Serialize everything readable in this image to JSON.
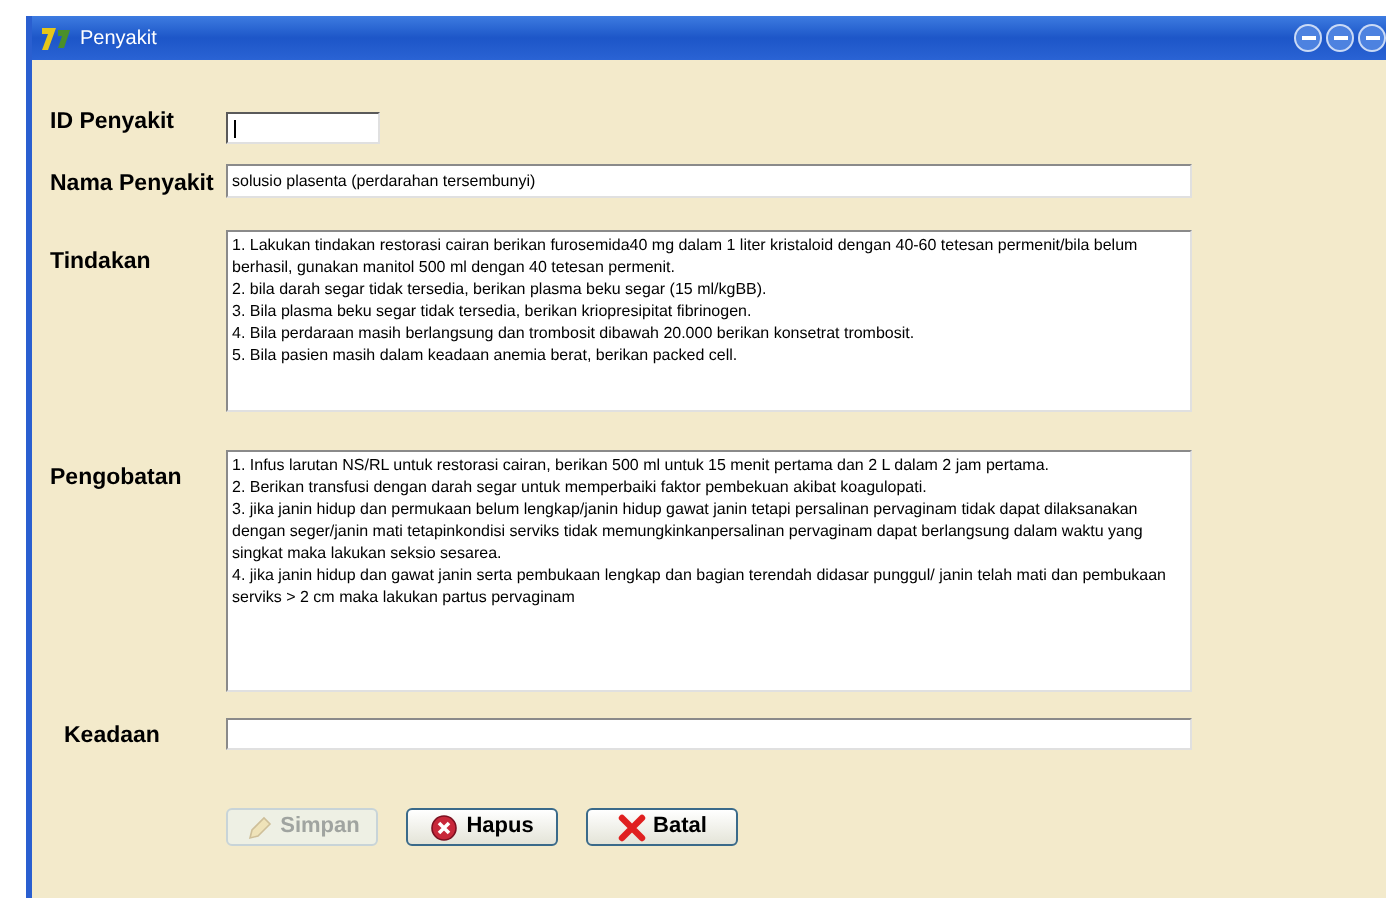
{
  "window": {
    "title": "Penyakit"
  },
  "fields": [
    {
      "label": "ID Penyakit",
      "kind": "short",
      "focused": true
    },
    {
      "label": "Nama Penyakit",
      "kind": "line",
      "value": "solusio plasenta (perdarahan tersembunyi)",
      "focused": false
    },
    {
      "label": "Tindakan",
      "kind": "area",
      "lines": [
        "1. Lakukan tindakan restorasi cairan berikan furosemida40 mg dalam 1 liter kristaloid dengan 40-60 tetesan permenit/bila belum berhasil, gunakan manitol 500 ml dengan 40 tetesan permenit.",
        "2. bila darah segar tidak tersedia, berikan plasma beku segar (15 ml/kgBB).",
        "3. Bila plasma beku segar tidak tersedia, berikan kriopresipitat fibrinogen.",
        "4. Bila perdaraan masih berlangsung dan trombosit dibawah 20.000 berikan konsetrat trombosit.",
        "5. Bila pasien masih dalam keadaan anemia berat, berikan packed cell."
      ],
      "focused": false
    },
    {
      "label": "Pengobatan",
      "kind": "area",
      "lines": [
        "1. Infus larutan NS/RL untuk restorasi cairan, berikan 500 ml untuk 15 menit pertama dan 2 L dalam 2 jam pertama.",
        "2. Berikan transfusi dengan darah segar untuk memperbaiki faktor pembekuan akibat koagulopati.",
        "3. jika janin hidup dan permukaan belum lengkap/janin hidup gawat janin tetapi persalinan pervaginam tidak dapat dilaksanakan dengan seger/janin mati tetapinkondisi serviks tidak memungkinkanpersalinan pervaginam dapat berlangsung dalam waktu yang singkat maka lakukan seksio sesarea.",
        "4. jika janin hidup dan gawat janin serta  pembukaan lengkap dan bagian terendah didasar punggul/ janin telah mati dan pembukaan serviks > 2 cm maka lakukan partus pervaginam"
      ],
      "focused": false
    },
    {
      "label": "Keadaan",
      "kind": "line",
      "focused": false
    }
  ],
  "buttons": [
    {
      "label": "Simpan",
      "disabled": true
    },
    {
      "label": "Hapus",
      "disabled": false
    },
    {
      "label": "Batal",
      "disabled": false
    }
  ]
}
